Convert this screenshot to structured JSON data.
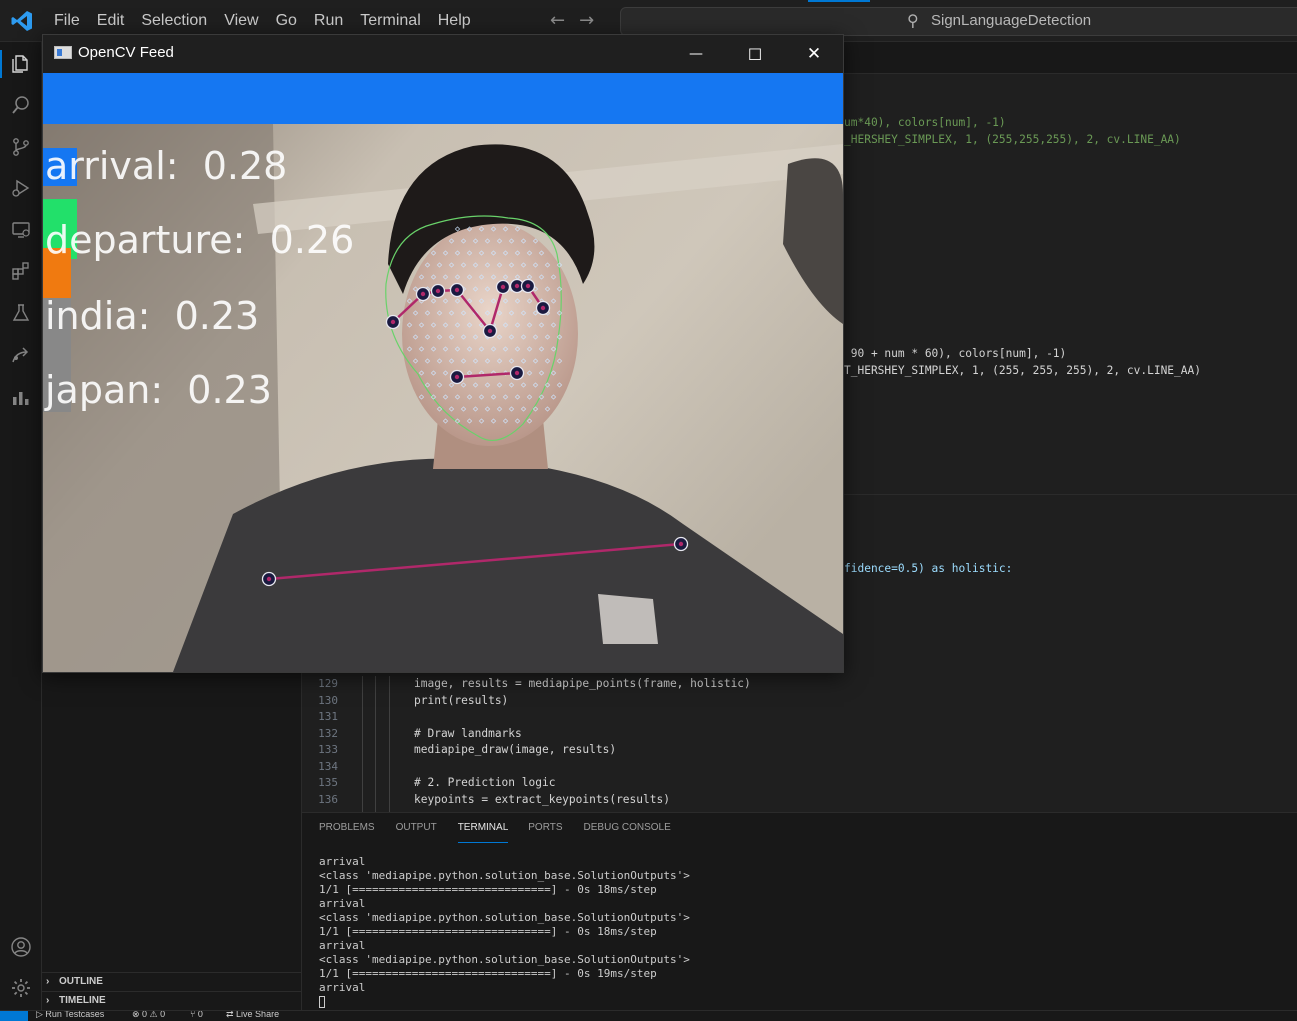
{
  "titlebar": {
    "menu": [
      "File",
      "Edit",
      "Selection",
      "View",
      "Go",
      "Run",
      "Terminal",
      "Help"
    ],
    "search_label": "SignLanguageDetection",
    "back_arrow": "←",
    "forward_arrow": "→"
  },
  "sidebar": {
    "sections": [
      "OUTLINE",
      "TIMELINE"
    ]
  },
  "editor": {
    "partial_lines": [
      {
        "segments": [
          [
            "um*40), colors[num], -1)",
            "c-green"
          ]
        ]
      },
      {
        "segments": [
          [
            "_HERSHEY_SIMPLEX, 1, (255,255,255), 2, cv.LINE_AA)",
            "c-green"
          ]
        ]
      },
      {
        "segments": [
          [
            " 90 + num * 60), colors[num], -1)",
            "c-mix1"
          ]
        ]
      },
      {
        "segments": [
          [
            "T_HERSHEY_SIMPLEX, 1, (255, 255, 255), 2, cv.LINE_AA)",
            "c-mix2"
          ]
        ]
      },
      {
        "segments": [
          [
            "fidence=0.5) as holistic:",
            "c-mix3"
          ]
        ]
      }
    ],
    "line_numbers": [
      "129",
      "130",
      "131",
      "132",
      "133",
      "134",
      "135",
      "136"
    ],
    "lines": [
      "image, results = mediapipe_points(frame, holistic)",
      "print(results)",
      "",
      "# Draw landmarks",
      "mediapipe_draw(image, results)",
      "",
      "# 2. Prediction logic",
      "keypoints = extract_keypoints(results)"
    ]
  },
  "panel": {
    "tabs": [
      "PROBLEMS",
      "OUTPUT",
      "TERMINAL",
      "PORTS",
      "DEBUG CONSOLE"
    ],
    "active_tab": "TERMINAL",
    "terminal_lines": [
      "arrival",
      "<class 'mediapipe.python.solution_base.SolutionOutputs'>",
      "1/1 [==============================] - 0s 18ms/step",
      "arrival",
      "<class 'mediapipe.python.solution_base.SolutionOutputs'>",
      "1/1 [==============================] - 0s 18ms/step",
      "arrival",
      "<class 'mediapipe.python.solution_base.SolutionOutputs'>",
      "1/1 [==============================] - 0s 19ms/step",
      "arrival"
    ]
  },
  "statusbar": {
    "run_testcases": "Run Testcases",
    "problems": "⊗ 0 ⚠ 0",
    "ports": "⑂ 0",
    "live_share": "Live Share"
  },
  "cv_window": {
    "title": "OpenCV Feed",
    "minimize": "—",
    "maximize": "☐",
    "close": "✕",
    "predictions": [
      {
        "label": "arrival:  0.28",
        "color": "#1577f2"
      },
      {
        "label": "departure:  0.26",
        "color": "#22e06a"
      },
      {
        "label": "india:  0.23",
        "color": "#f07a10"
      },
      {
        "label": "japan:  0.23",
        "color": "#888888"
      }
    ]
  }
}
